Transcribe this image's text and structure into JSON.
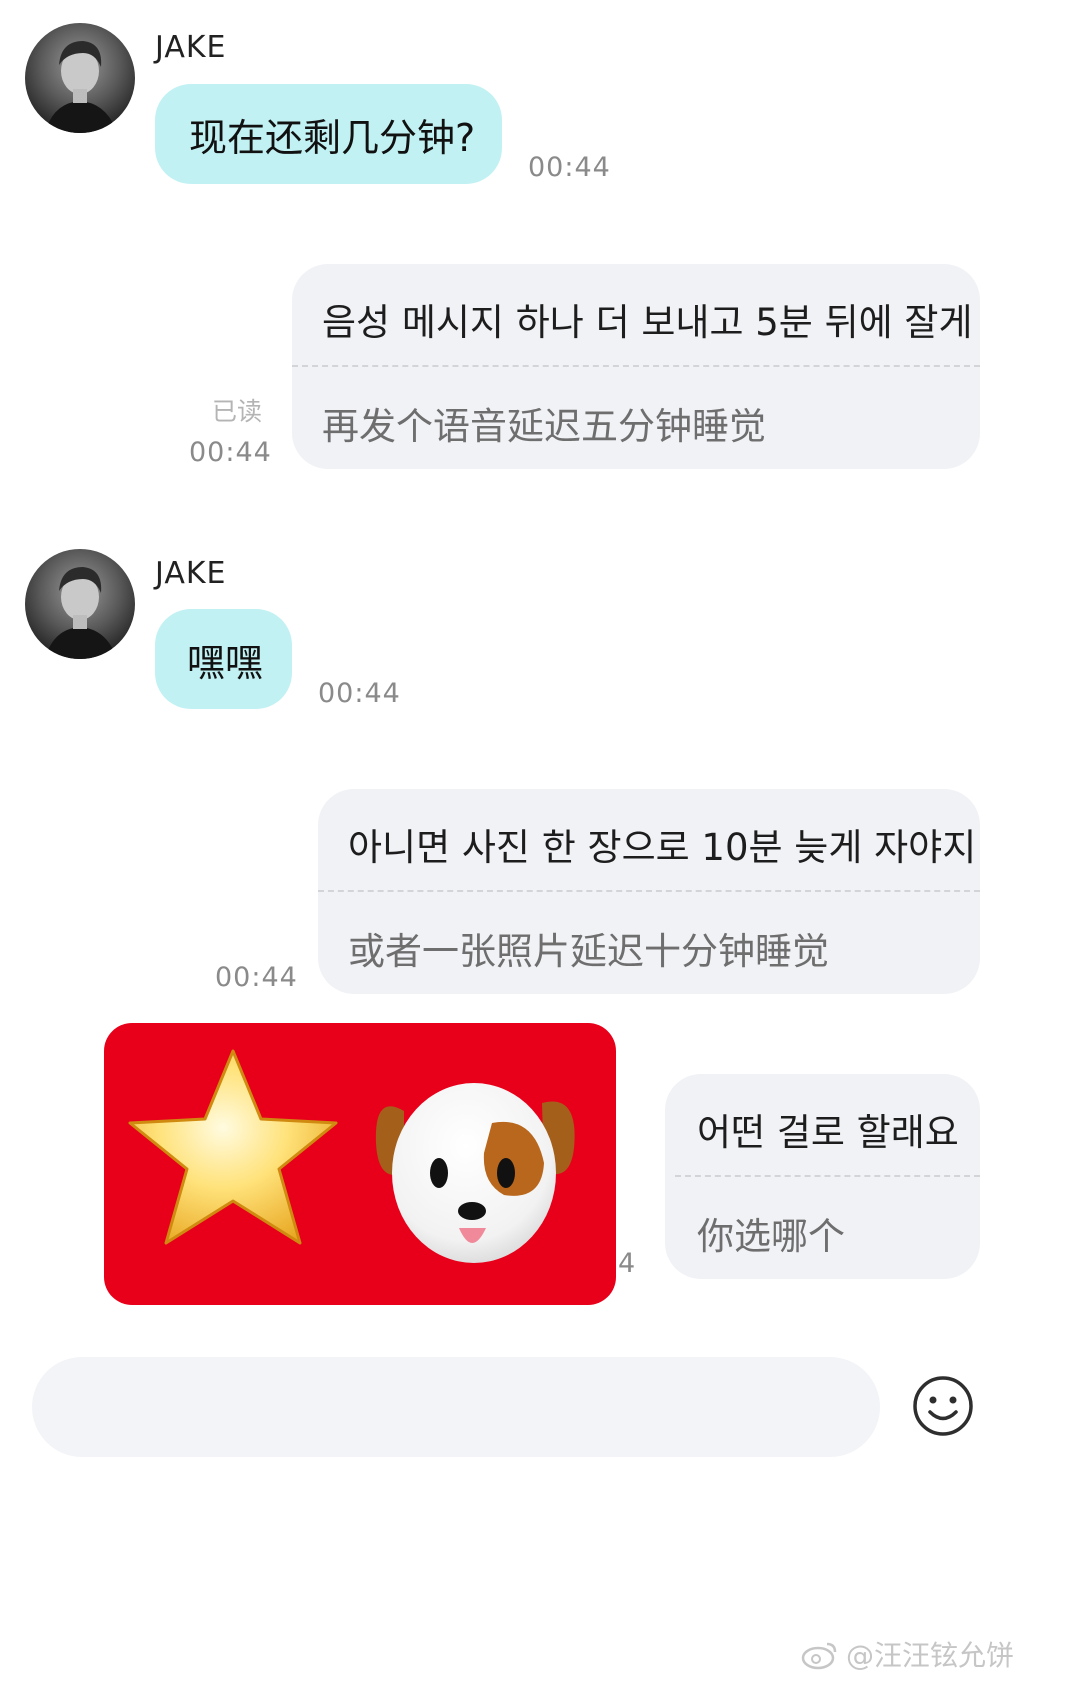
{
  "messages": [
    {
      "sender": "JAKE",
      "text": "现在还剩几分钟?",
      "time": "00:44"
    },
    {
      "ko": "음성 메시지 하나 더 보내고 5분 뒤에 잘게",
      "zh": "再发个语音延迟五分钟睡觉",
      "read": "已读",
      "time": "00:44"
    },
    {
      "sender": "JAKE",
      "text": "嘿嘿",
      "time": "00:44"
    },
    {
      "ko": "아니면 사진 한 장으로 10분 늦게 자야지",
      "zh": "或者一张照片延迟十分钟睡觉",
      "time": "00:44"
    },
    {
      "ko": "어떤 걸로 할래요",
      "zh": "你选哪个",
      "time_partial": "4"
    }
  ],
  "sticker": {
    "items": [
      "star-icon",
      "dog-face-icon"
    ],
    "background": "#e8001b"
  },
  "input": {
    "placeholder": ""
  },
  "emoji_button": "smiley-icon",
  "watermark": "@汪汪铉允饼",
  "colors": {
    "incoming_bubble": "#c2f1f3",
    "outgoing_bubble": "#f1f2f6",
    "sticker_bg": "#e8001b"
  }
}
